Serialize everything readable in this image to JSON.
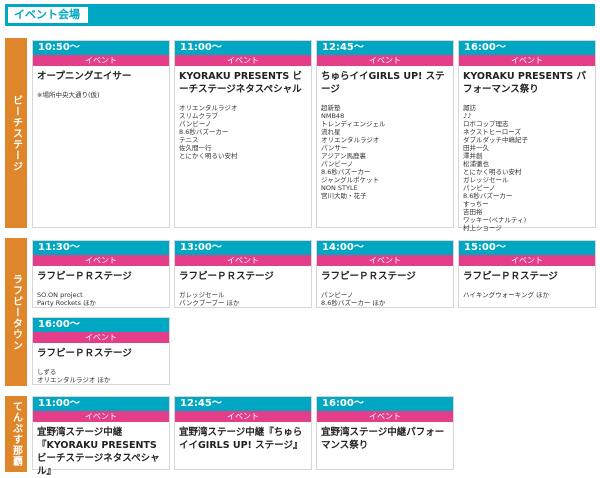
{
  "header": {
    "title": "イベント会場"
  },
  "sections": [
    {
      "label": "ビーチステージ"
    },
    {
      "label": "ラフピータウン"
    },
    {
      "label": "てんぷす那覇"
    }
  ],
  "category_label": "イベント",
  "cards": [
    {
      "time": "10:50〜",
      "title": "オープニングエイサー",
      "performers": [
        "※場所中央大通り(仮)"
      ]
    },
    {
      "time": "11:00〜",
      "title": "KYORAKU PRESENTS ビーチステージネタスペシャル",
      "performers": [
        "オリエンタルラジオ",
        "スリムクラブ",
        "パンビーノ",
        "8.6秒バズーカー",
        "テニス",
        "佐久間一行",
        "とにかく明るい安村"
      ]
    },
    {
      "time": "12:45〜",
      "title": "ちゅらイイGIRLS UP! ステージ",
      "performers": [
        "超新塾",
        "NMB48",
        "トレンディエンジェル",
        "流れ星",
        "オリエンタルラジオ",
        "パンサー",
        "アジアン馬鹿裏",
        "パンビーノ",
        "8.6秒バズーカー",
        "ジャングルポケット",
        "NON STYLE",
        "宮川大助・花子"
      ]
    },
    {
      "time": "16:00〜",
      "title": "KYORAKU PRESENTS パフォーマンス祭り",
      "performers": [
        "諏訪",
        "♪♪",
        "ロボコップ理志",
        "ネクストヒーローズ",
        "ダブルダッチ中嶋紀子",
        "田井一久",
        "澤井創",
        "松浦徹也",
        "とにかく明るい安村",
        "ガレッジセール",
        "パンビーノ",
        "8.6秒バズーカー",
        "すっちー",
        "吉田裕",
        "ワッキー(ペナルティ)",
        "村上ショージ"
      ]
    },
    {
      "time": "11:30〜",
      "title": "ラフピーＰＲステージ",
      "performers": [
        "SO.ON project",
        "Party Rockets ほか"
      ]
    },
    {
      "time": "13:00〜",
      "title": "ラフピーＰＲステージ",
      "performers": [
        "ガレッジセール",
        "パンクブーブー ほか"
      ]
    },
    {
      "time": "14:00〜",
      "title": "ラフピーＰＲステージ",
      "performers": [
        "パンビーノ",
        "8.6秒バズーカー ほか"
      ]
    },
    {
      "time": "15:00〜",
      "title": "ラフピーＰＲステージ",
      "performers": [
        "ハイキングウォーキング ほか"
      ]
    },
    {
      "time": "16:00〜",
      "title": "ラフピーＰＲステージ",
      "performers": [
        "しずる",
        "オリエンタルラジオ ほか"
      ]
    },
    {
      "time": "11:00〜",
      "title": "宜野湾ステージ中継『KYORAKU PRESENTS ビーチステージネタスペシャル』",
      "performers": []
    },
    {
      "time": "12:45〜",
      "title": "宜野湾ステージ中継『ちゅらイイGIRLS UP! ステージ』",
      "performers": []
    },
    {
      "time": "16:00〜",
      "title": "宜野湾ステージ中継パフォーマンス祭り",
      "performers": []
    }
  ],
  "colors": {
    "accent": "#00a7c3",
    "category": "#e43d8a",
    "section": "#e0862a"
  }
}
